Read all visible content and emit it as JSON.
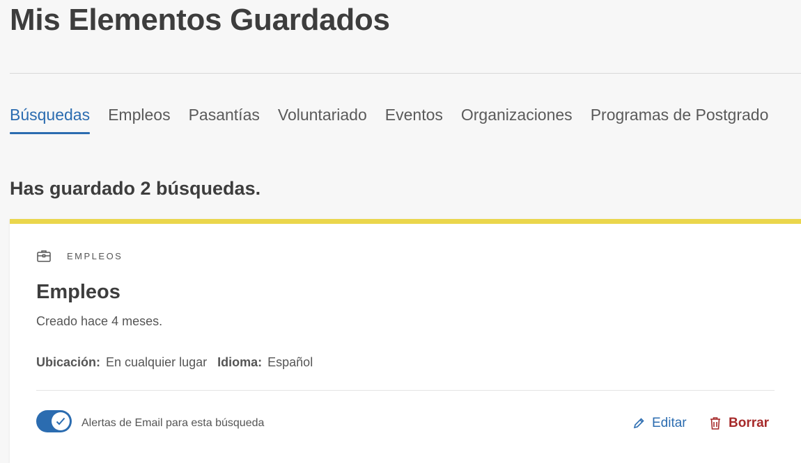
{
  "page": {
    "title": "Mis Elementos Guardados"
  },
  "tabs": [
    {
      "label": "Búsquedas",
      "active": true
    },
    {
      "label": "Empleos",
      "active": false
    },
    {
      "label": "Pasantías",
      "active": false
    },
    {
      "label": "Voluntariado",
      "active": false
    },
    {
      "label": "Eventos",
      "active": false
    },
    {
      "label": "Organizaciones",
      "active": false
    },
    {
      "label": "Programas de Postgrado",
      "active": false
    }
  ],
  "summary": {
    "saved_count_text": "Has guardado 2 búsquedas."
  },
  "card": {
    "category_icon": "briefcase-icon",
    "category_label": "EMPLEOS",
    "title": "Empleos",
    "created": "Creado hace 4 meses.",
    "filters": [
      {
        "label": "Ubicación:",
        "value": "En cualquier lugar"
      },
      {
        "label": "Idioma:",
        "value": "Español"
      }
    ],
    "email_alert_label": "Alertas de Email para esta búsqueda",
    "email_alert_enabled": true,
    "edit_label": "Editar",
    "edit_icon": "pencil-icon",
    "delete_label": "Borrar",
    "delete_icon": "trash-icon"
  },
  "colors": {
    "accent": "#2b6cb0",
    "danger": "#a62a2a",
    "card_top_border": "#ead64c"
  }
}
